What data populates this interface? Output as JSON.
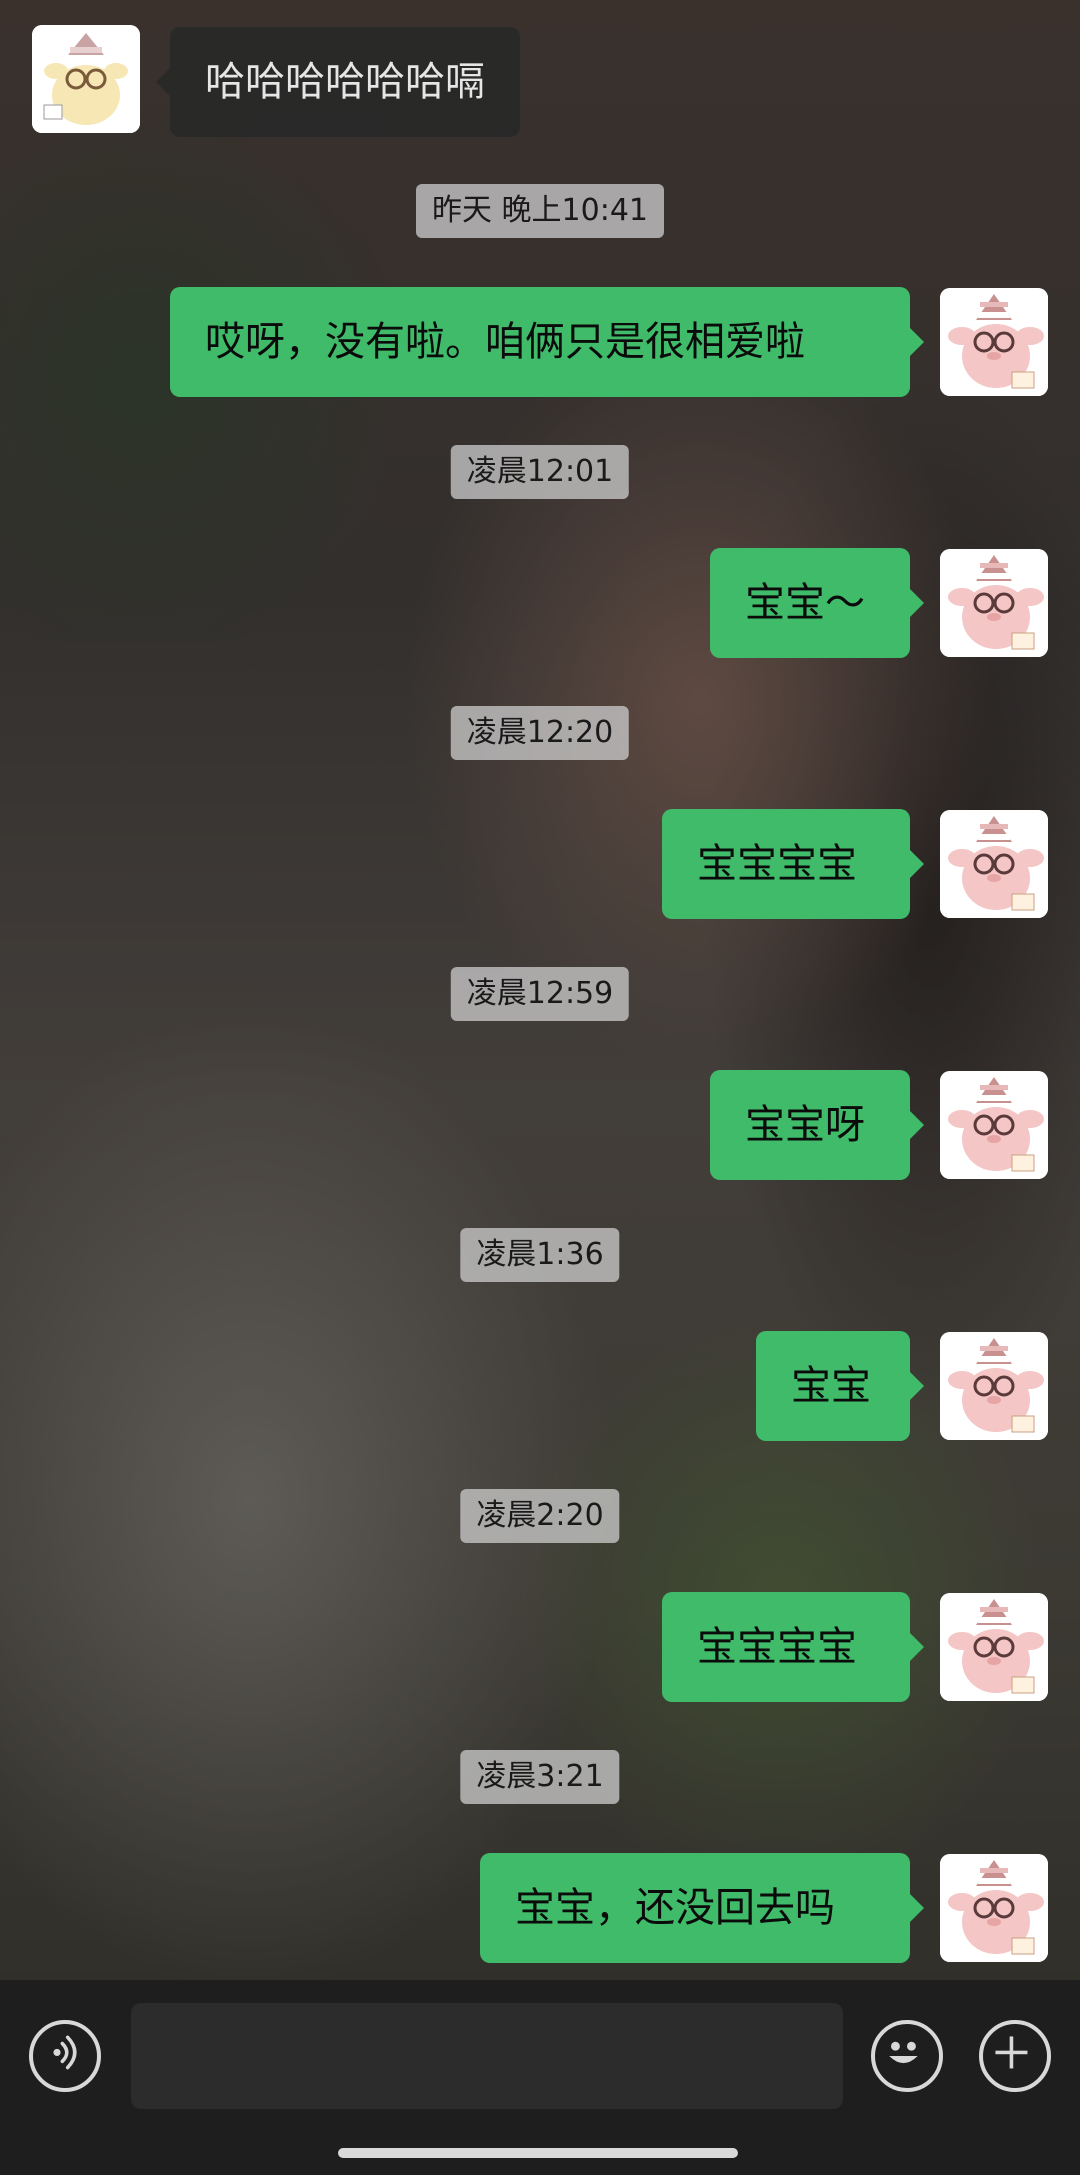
{
  "chat": {
    "incoming_message": "哈哈哈哈哈哈嗝",
    "entries": [
      {
        "time": "昨天 晚上10:41",
        "message": "哎呀，没有啦。咱俩只是很相爱啦"
      },
      {
        "time": "凌晨12:01",
        "message": "宝宝～"
      },
      {
        "time": "凌晨12:20",
        "message": "宝宝宝宝"
      },
      {
        "time": "凌晨12:59",
        "message": "宝宝呀"
      },
      {
        "time": "凌晨1:36",
        "message": "宝宝"
      },
      {
        "time": "凌晨2:20",
        "message": "宝宝宝宝"
      },
      {
        "time": "凌晨3:21",
        "message": "宝宝，还没回去吗"
      }
    ]
  },
  "input_bar": {
    "voice_icon": "voice-icon",
    "emoji_icon": "emoji-icon",
    "plus_icon": "plus-icon",
    "placeholder": ""
  },
  "colors": {
    "outgoing_bubble": "#3fbb6a",
    "incoming_bubble": "#282828",
    "input_bar_bg": "#1e1e1e"
  }
}
